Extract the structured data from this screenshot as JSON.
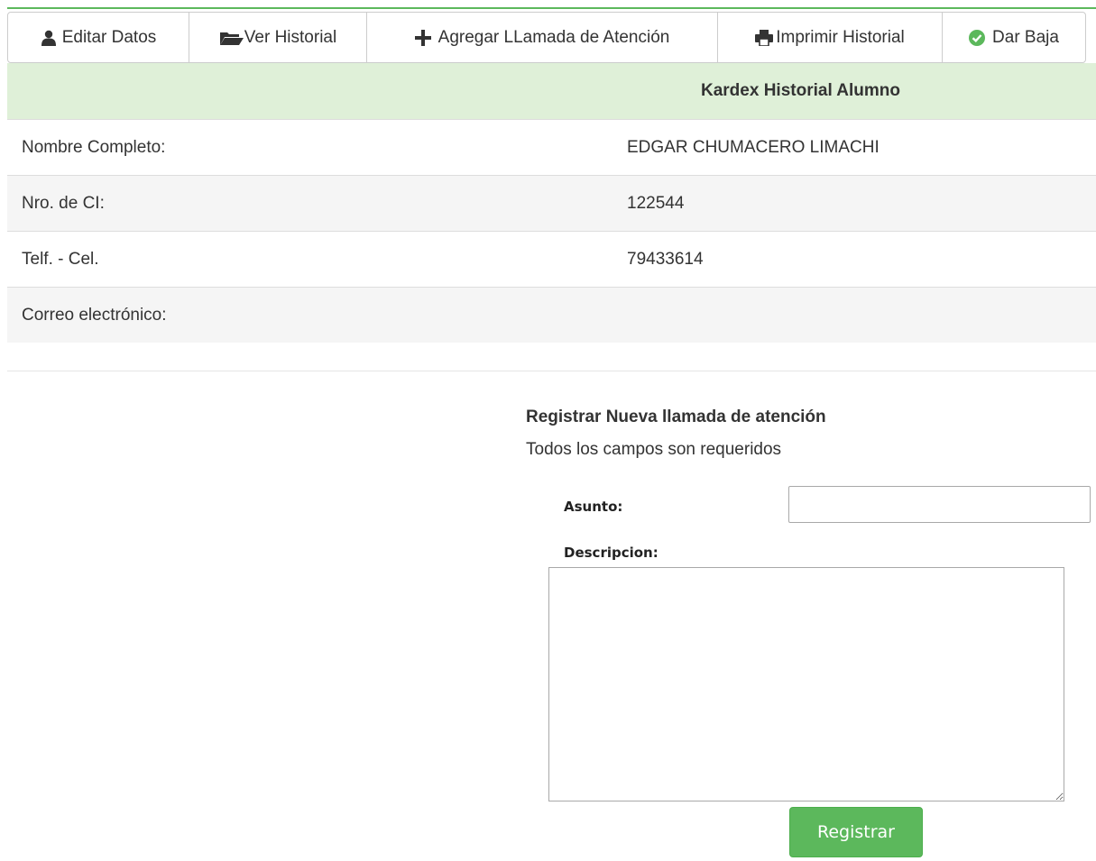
{
  "accent_color": "#5cb85c",
  "toolbar": {
    "buttons": [
      {
        "label": "Editar Datos",
        "icon": "user-icon"
      },
      {
        "label": "Ver Historial",
        "icon": "folder-open-icon"
      },
      {
        "label": "Agregar LLamada de Atención",
        "icon": "plus-icon"
      },
      {
        "label": "Imprimir Historial",
        "icon": "print-icon"
      },
      {
        "label": "Dar Baja",
        "icon": "check-circle-icon"
      }
    ]
  },
  "kardex": {
    "title": "Kardex Historial Alumno",
    "header_color": "#dff0d8",
    "rows": [
      {
        "label": "Nombre Completo:",
        "value": "EDGAR CHUMACERO LIMACHI"
      },
      {
        "label": "Nro. de CI:",
        "value": "122544"
      },
      {
        "label": "Telf. - Cel.",
        "value": "79433614"
      },
      {
        "label": "Correo electrónico:",
        "value": ""
      }
    ]
  },
  "form": {
    "title": "Registrar Nueva llamada de atención",
    "subtitle": "Todos los campos son requeridos",
    "asunto_label": "Asunto:",
    "asunto_value": "",
    "descripcion_label": "Descripcion:",
    "descripcion_value": "",
    "submit_label": "Registrar"
  }
}
